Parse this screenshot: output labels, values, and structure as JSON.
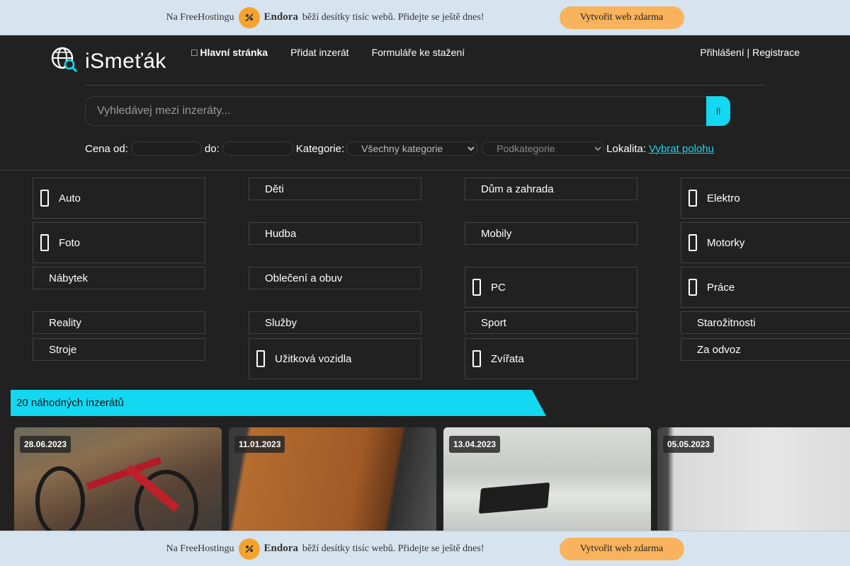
{
  "promo": {
    "pre_text": "Na FreeHostingu",
    "brand": "Endora",
    "post_text": "běží desítky tisíc webů. Přidejte se ještě dnes!",
    "button_label": "Vytvořit web zdarma",
    "accent_color": "#f9b35c"
  },
  "header": {
    "logo_text": "iSmeťák",
    "nav": [
      {
        "label": "Hlavní stránka",
        "icon": "home-icon"
      },
      {
        "label": "Přidat inzerát"
      },
      {
        "label": "Formuláře ke stažení"
      }
    ],
    "auth": {
      "login": "Přihlášení",
      "separator": " | ",
      "register": "Registrace"
    }
  },
  "search": {
    "placeholder": "Vyhledávej mezi inzeráty...",
    "button_icon": "search-icon",
    "accent_color": "#12d8f2"
  },
  "filters": {
    "price_from_label": "Cena od:",
    "price_to_label": "do:",
    "category_label": "Kategorie:",
    "category_value": "Všechny kategorie",
    "subcategory_value": "Podkategorie",
    "location_label": "Lokalita:",
    "location_link": "Vybrat polohu"
  },
  "categories": [
    {
      "label": "Auto",
      "icon": "car-icon"
    },
    {
      "label": "Děti"
    },
    {
      "label": "Dům a zahrada"
    },
    {
      "label": "Elektro",
      "icon": "plug-icon"
    },
    {
      "label": "Foto",
      "icon": "camera-icon"
    },
    {
      "label": "Hudba"
    },
    {
      "label": "Mobily"
    },
    {
      "label": "Motorky",
      "icon": "motorcycle-icon"
    },
    {
      "label": "Nábytek"
    },
    {
      "label": "Oblečení a obuv"
    },
    {
      "label": "PC",
      "icon": "computer-icon"
    },
    {
      "label": "Práce",
      "icon": "briefcase-icon"
    },
    {
      "label": "Reality"
    },
    {
      "label": "Služby"
    },
    {
      "label": "Sport"
    },
    {
      "label": "Starožitnosti"
    },
    {
      "label": "Stroje"
    },
    {
      "label": "Užitková vozidla",
      "icon": "truck-icon"
    },
    {
      "label": "Zvířata",
      "icon": "paw-icon"
    },
    {
      "label": "Za odvoz"
    }
  ],
  "random_section": {
    "title": "20 náhodných inzerátů",
    "cards": [
      {
        "date": "28.06.2023"
      },
      {
        "date": "11.01.2023"
      },
      {
        "date": "13.04.2023"
      },
      {
        "date": "05.05.2023"
      }
    ]
  }
}
